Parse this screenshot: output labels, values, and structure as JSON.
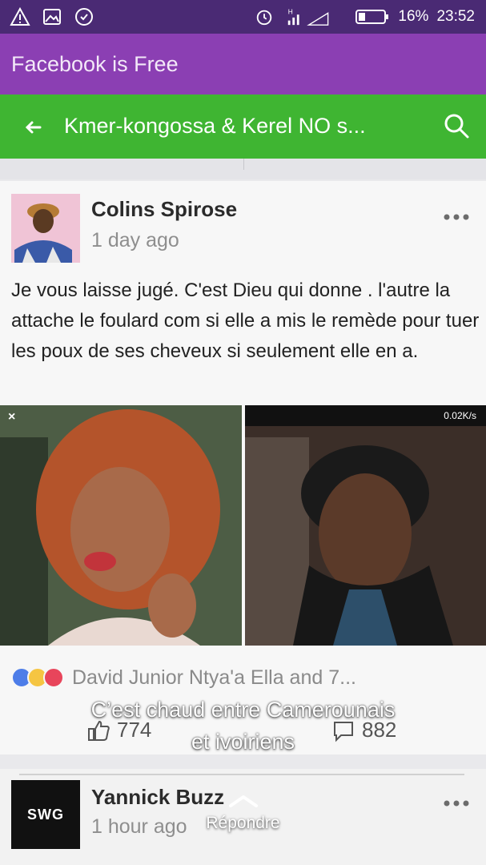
{
  "status_bar": {
    "battery": "16%",
    "time": "23:52",
    "network": "H",
    "icons": [
      "warning-icon",
      "gallery-icon",
      "data-saver-icon",
      "alarm-icon",
      "signal-icon",
      "battery-icon"
    ]
  },
  "banner": {
    "text": "Facebook is Free"
  },
  "toolbar": {
    "title": "Kmer-kongossa & Kerel NO s...",
    "icons": [
      "back-arrow-icon",
      "search-icon"
    ]
  },
  "post": {
    "author": "Colins Spirose",
    "time": "1 day ago",
    "text": "Je vous laisse jugé. C'est Dieu qui donne . l'autre la attache le foulard com si elle a mis le remède pour tuer les poux de ses cheveux si seulement elle en a.",
    "inner_status_speed": "0.02K/s",
    "reactors": "David Junior Ntya'a Ella and 7...",
    "likes": "774",
    "comments": "882"
  },
  "next_post": {
    "author": "Yannick Buzz",
    "time": "1 hour ago",
    "logo_text": "SWG"
  },
  "overlay": {
    "caption_line1": "C’est chaud entre Camerounais",
    "caption_line2": "et ivoiriens",
    "reply_label": "Répondre"
  },
  "colors": {
    "status_bar": "#4a2a74",
    "banner": "#8b3fb3",
    "toolbar": "#3fb532",
    "like": "#4d7de8",
    "haha": "#f5c542",
    "love": "#e8455b"
  }
}
